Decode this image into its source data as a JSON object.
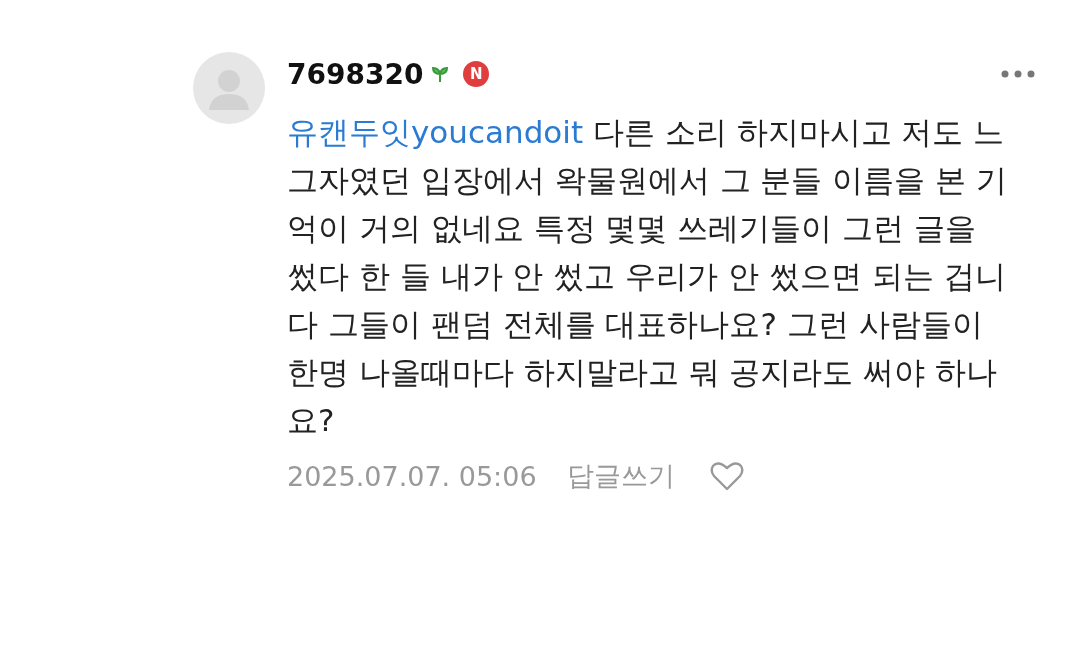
{
  "comment": {
    "author": "7698320",
    "badges": [
      {
        "kind": "sprout"
      },
      {
        "kind": "new",
        "label": "N"
      }
    ],
    "mention": "유캔두잇youcandoit",
    "text": "다른 소리 하지마시고 저도 느그자였던 입장에서 왁물원에서 그 분들 이름을 본 기억이 거의 없네요 특정 몇몇 쓰레기들이 그런 글을 썼다 한 들 내가 안 썼고 우리가 안 썼으면 되는 겁니다 그들이 팬덤 전체를 대표하나요? 그런 사람들이 한명 나올때마다 하지말라고 뭐 공지라도 써야 하나요?",
    "date": "2025.07.07. 05:06",
    "reply_label": "답글쓰기",
    "liked": false
  }
}
